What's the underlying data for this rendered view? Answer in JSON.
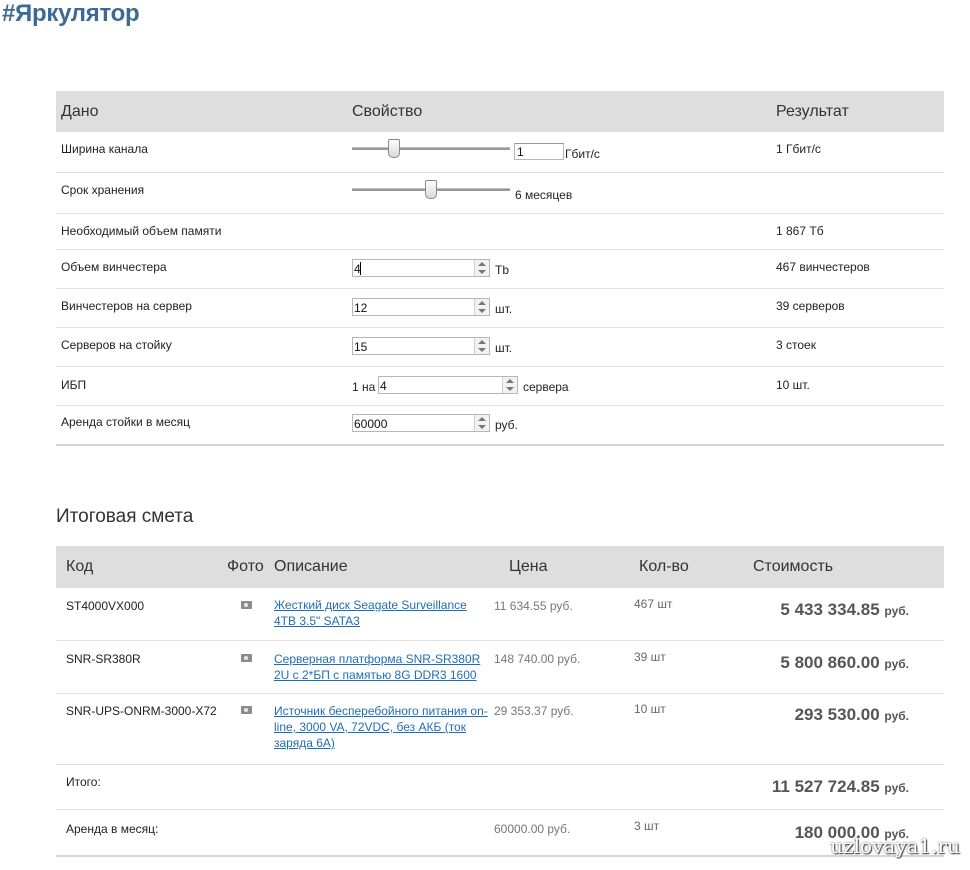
{
  "page_title": "#Яркулятор",
  "params": {
    "headers": {
      "given": "Дано",
      "property": "Свойство",
      "result": "Результат"
    },
    "bandwidth": {
      "label": "Ширина канала",
      "value": "1",
      "unit": "Гбит/с",
      "result": "1 Гбит/с"
    },
    "retention": {
      "label": "Срок хранения",
      "value_text": "6 месяцев",
      "result": ""
    },
    "memory": {
      "label": "Необходимый объем памяти",
      "result": "1 867 Тб"
    },
    "hdd_size": {
      "label": "Объем винчестера",
      "value": "4",
      "unit": "Tb",
      "result": "467 винчестеров"
    },
    "hdd_per_server": {
      "label": "Винчестеров на сервер",
      "value": "12",
      "unit": "шт.",
      "result": "39 серверов"
    },
    "servers_per_rack": {
      "label": "Серверов на стойку",
      "value": "15",
      "unit": "шт.",
      "result": "3 стоек"
    },
    "ups": {
      "label": "ИБП",
      "prefix": "1 на",
      "value": "4",
      "unit": "сервера",
      "result": "10 шт."
    },
    "rack_rent": {
      "label": "Аренда стойки в месяц",
      "value": "60000",
      "unit": "руб.",
      "result": ""
    }
  },
  "estimate": {
    "title": "Итоговая смета",
    "headers": {
      "code": "Код",
      "photo": "Фото",
      "description": "Описание",
      "price": "Цена",
      "qty": "Кол-во",
      "cost": "Стоимость"
    },
    "rows": [
      {
        "code": "ST4000VX000",
        "description": "Жесткий диск Seagate Surveillance 4TB 3.5\" SATA3",
        "price": "11 634.55 руб.",
        "qty": "467 шт",
        "cost": "5 433 334.85",
        "currency": "руб."
      },
      {
        "code": "SNR-SR380R",
        "description": "Серверная платформа SNR-SR380R 2U с 2*БП с памятью 8G DDR3 1600",
        "price": "148 740.00 руб.",
        "qty": "39 шт",
        "cost": "5 800 860.00",
        "currency": "руб."
      },
      {
        "code": "SNR-UPS-ONRM-3000-X72",
        "description": "Источник бесперебойного питания on-line, 3000 VA, 72VDC, без АКБ (ток заряда 6А)",
        "price": "29 353.37 руб.",
        "qty": "10 шт",
        "cost": "293 530.00",
        "currency": "руб."
      }
    ],
    "total": {
      "label": "Итого:",
      "cost": "11 527 724.85",
      "currency": "руб."
    },
    "rent": {
      "label": "Аренда в месяц:",
      "price": "60000.00 руб.",
      "qty": "3 шт",
      "cost": "180 000.00",
      "currency": "руб."
    }
  },
  "watermark": "uzlovaya1.ru",
  "sliders": {
    "bandwidth_position": 0.23,
    "retention_position": 0.46
  }
}
